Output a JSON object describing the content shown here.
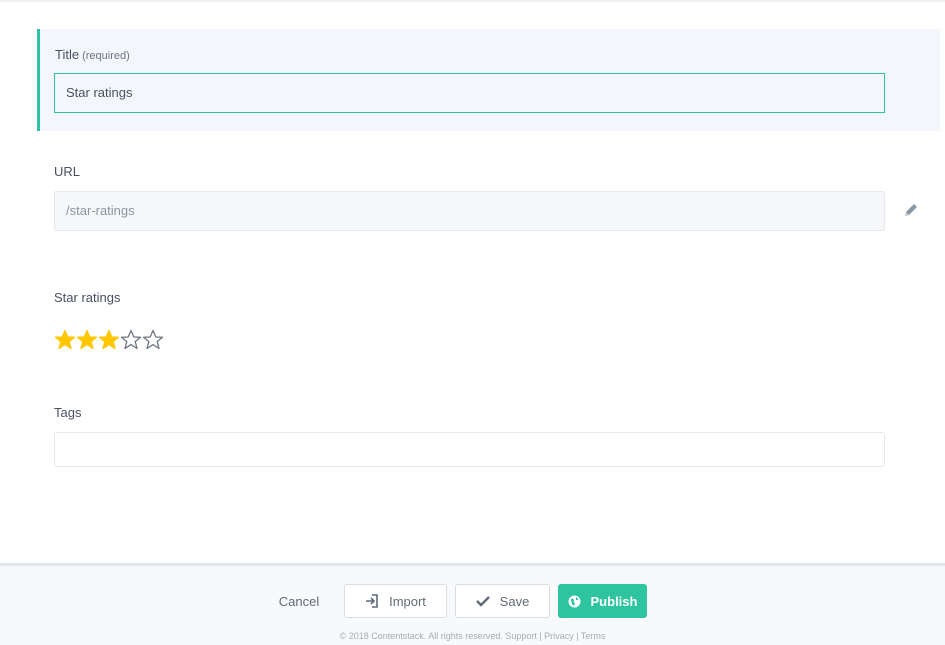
{
  "title_field": {
    "label": "Title",
    "required_hint": "(required)",
    "value": "Star ratings"
  },
  "url_field": {
    "label": "URL",
    "value": "/star-ratings",
    "edit_icon": "pencil-icon"
  },
  "rating_field": {
    "label": "Star ratings",
    "rating": 3,
    "max": 5,
    "filled_color": "#ffc700",
    "empty_color": "#6c7580"
  },
  "tags_field": {
    "label": "Tags",
    "value": ""
  },
  "footer": {
    "cancel_label": "Cancel",
    "import_label": "Import",
    "save_label": "Save",
    "publish_label": "Publish",
    "copyright": "© 2018 Contentstack. All rights reserved. Support | Privacy | Terms"
  },
  "colors": {
    "accent": "#2ec4a0"
  }
}
